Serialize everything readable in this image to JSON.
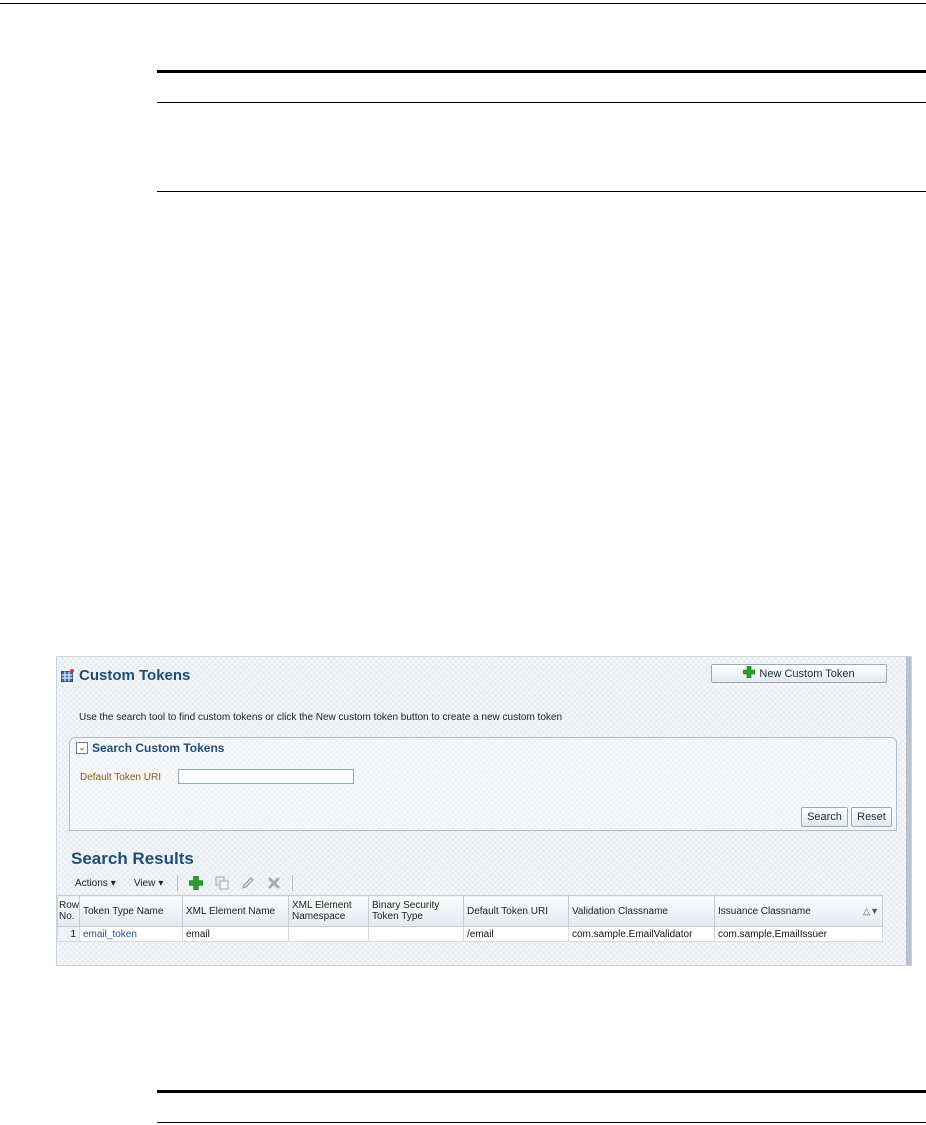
{
  "app": {
    "title": "Custom Tokens",
    "new_button": "New Custom Token",
    "intro": "Use the search tool to find custom tokens or click the New custom token button to create a new custom token"
  },
  "search": {
    "title": "Search Custom Tokens",
    "field_label": "Default Token URI",
    "field_value": "",
    "search_button": "Search",
    "reset_button": "Reset"
  },
  "results": {
    "title": "Search Results",
    "toolbar": {
      "actions": "Actions",
      "view": "View"
    },
    "columns": [
      "Row No.",
      "Token Type Name",
      "XML Element Name",
      "XML Element Namespace",
      "Binary Security Token Type",
      "Default Token URI",
      "Validation Classname",
      "Issuance Classname"
    ],
    "rows": [
      {
        "row_no": "1",
        "token_type_name": "email_token",
        "xml_element_name": "email",
        "xml_element_namespace": "",
        "binary_security_token_type": "",
        "default_token_uri": "/email",
        "validation_classname": "com.sample.EmailValidator",
        "issuance_classname": "com.sample.EmailIssuer"
      }
    ]
  },
  "colors": {
    "title_blue": "#1f4e79",
    "link_blue": "#1a4fa0",
    "label_brown": "#8a5a1a",
    "add_green": "#2e9e2e"
  },
  "icons": [
    "table-grid-icon",
    "add-icon",
    "duplicate-icon",
    "edit-icon",
    "delete-icon",
    "collapse-icon",
    "chevron-down-icon",
    "sort-icon"
  ]
}
